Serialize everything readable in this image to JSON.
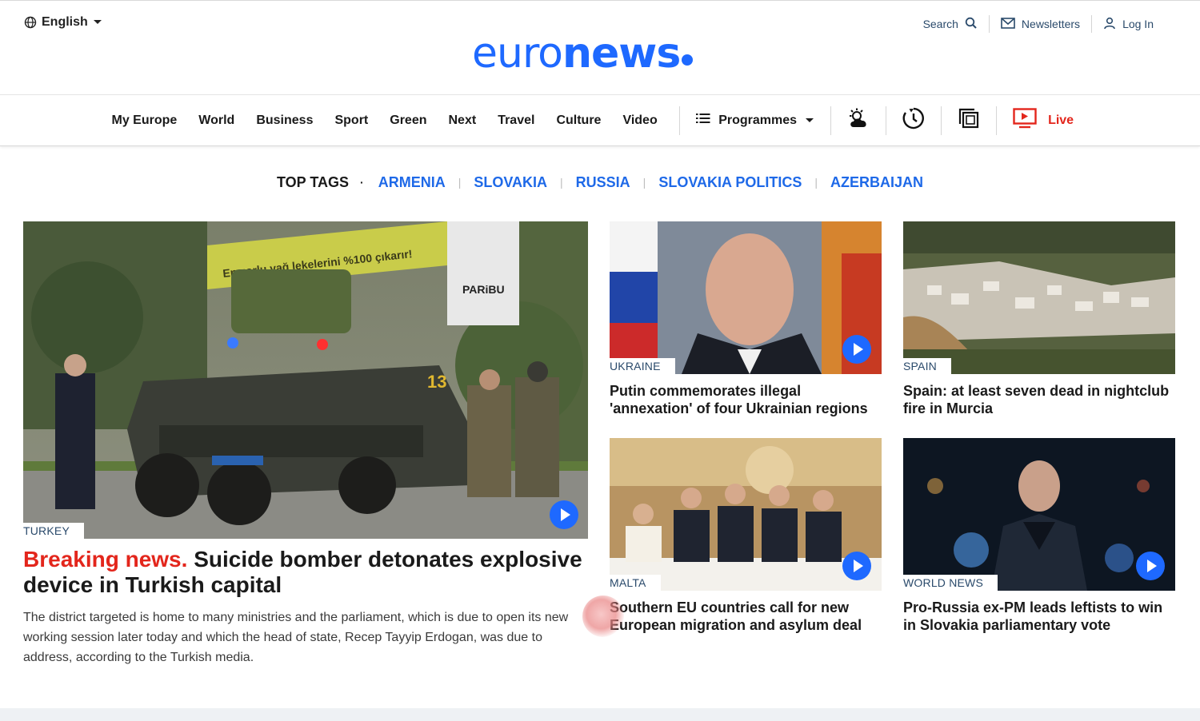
{
  "header": {
    "language": "English",
    "logo": {
      "light": "euro",
      "bold": "news"
    },
    "search_label": "Search",
    "newsletters_label": "Newsletters",
    "login_label": "Log In"
  },
  "nav": {
    "items": [
      "My Europe",
      "World",
      "Business",
      "Sport",
      "Green",
      "Next",
      "Travel",
      "Culture",
      "Video"
    ],
    "programmes_label": "Programmes",
    "live_label": "Live"
  },
  "top_tags": {
    "title": "TOP TAGS",
    "tags": [
      "ARMENIA",
      "SLOVAKIA",
      "RUSSIA",
      "SLOVAKIA POLITICS",
      "AZERBAIJAN"
    ]
  },
  "main_story": {
    "kicker": "TURKEY",
    "breaking_label": "Breaking news.",
    "title": "Suicide bomber detonates explosive device in Turkish capital",
    "summary": "The district targeted is home to many ministries and the parliament, which is due to open its new working session later today and which the head of state, Recep Tayyip Erdogan, was due to address, according to the Turkish media."
  },
  "cards": [
    {
      "kicker": "UKRAINE",
      "title": "Putin commemorates illegal 'annexation' of four Ukrainian regions",
      "video": true
    },
    {
      "kicker": "SPAIN",
      "title": "Spain: at least seven dead in nightclub fire in Murcia",
      "video": false
    },
    {
      "kicker": "MALTA",
      "title": "Southern EU countries call for new European migration and asylum deal",
      "video": true
    },
    {
      "kicker": "WORLD NEWS",
      "title": "Pro-Russia ex-PM leads leftists to win in Slovakia parliamentary vote",
      "video": true
    }
  ],
  "colors": {
    "brand_blue": "#1e69ff",
    "live_red": "#e3261c",
    "breaking_red": "#e3261c",
    "tag_blue": "#1e69e8"
  }
}
